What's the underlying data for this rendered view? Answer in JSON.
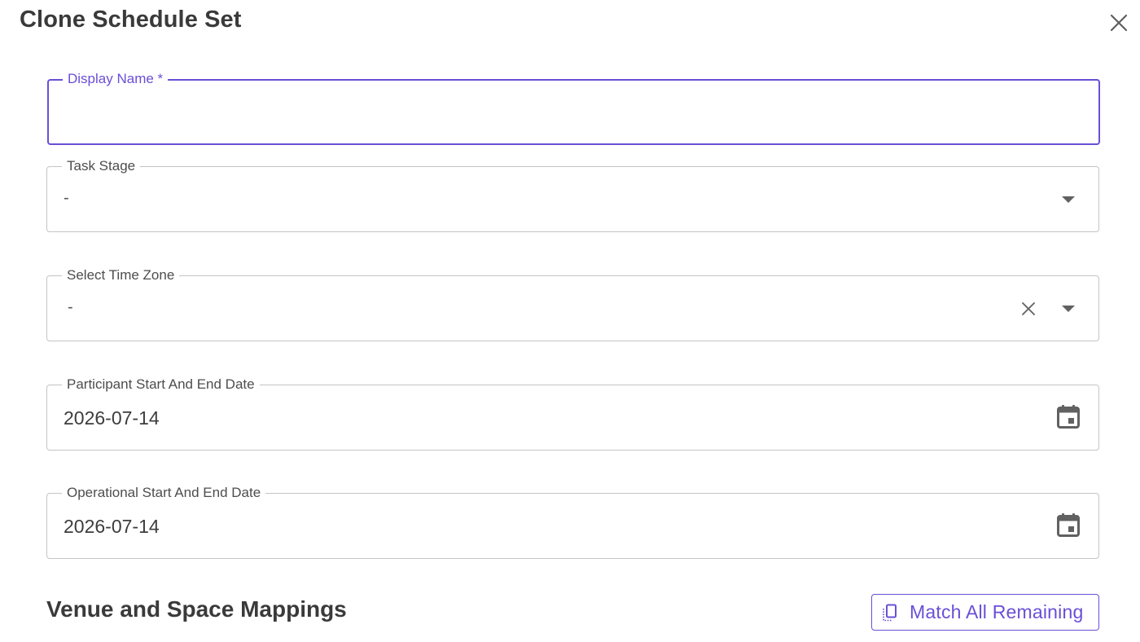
{
  "dialog": {
    "title": "Clone Schedule Set"
  },
  "form": {
    "display_name": {
      "label": "Display Name *",
      "value": ""
    },
    "task_stage": {
      "label": "Task Stage",
      "value": "-"
    },
    "time_zone": {
      "label": "Select Time Zone",
      "value": "-"
    },
    "participant_dates": {
      "label": "Participant Start And End Date",
      "value": "2026-07-14"
    },
    "operational_dates": {
      "label": "Operational Start And End Date",
      "value": "2026-07-14"
    }
  },
  "mappings": {
    "section_title": "Venue and Space Mappings",
    "match_all_label": "Match All Remaining"
  },
  "icons": {
    "close": "close-icon",
    "dropdown": "arrow-drop-down-icon",
    "clear": "clear-icon",
    "calendar": "calendar-icon",
    "match": "copy-icon"
  },
  "colors": {
    "accent": "#6a4fd6",
    "border": "#c4c4c4",
    "text": "#3a3a3a",
    "icon": "#616161"
  }
}
